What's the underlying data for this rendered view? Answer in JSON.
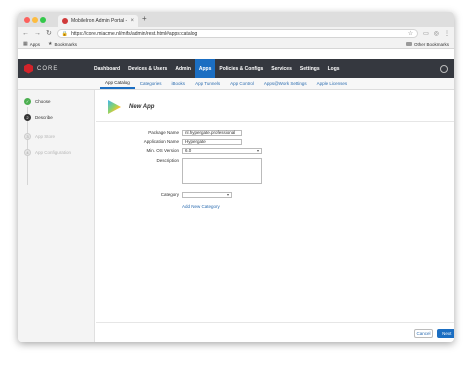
{
  "browser": {
    "tab_title": "MobileIron Admin Portal - Unif",
    "tab_close": "×",
    "new_tab": "+",
    "url": "https://core.miacme.nl/mifs/admin/rest.html#apps:catalog",
    "nav_back": "←",
    "nav_forward": "→",
    "nav_reload": "↻",
    "star": "☆",
    "bookmarks": {
      "apps": "Apps",
      "bookmarks": "Bookmarks",
      "other": "Other Bookmarks"
    }
  },
  "app": {
    "logo_text": "CORE",
    "nav": [
      {
        "label": "Dashboard",
        "active": false
      },
      {
        "label": "Devices & Users",
        "active": false
      },
      {
        "label": "Admin",
        "active": false
      },
      {
        "label": "Apps",
        "active": true
      },
      {
        "label": "Policies & Configs",
        "active": false
      },
      {
        "label": "Services",
        "active": false
      },
      {
        "label": "Settings",
        "active": false
      },
      {
        "label": "Logs",
        "active": false
      }
    ],
    "subnav": [
      {
        "label": "App Catalog",
        "active": true
      },
      {
        "label": "Categories",
        "active": false
      },
      {
        "label": "iBooks",
        "active": false
      },
      {
        "label": "App Tunnels",
        "active": false
      },
      {
        "label": "App Control",
        "active": false
      },
      {
        "label": "Apps@Work Settings",
        "active": false
      },
      {
        "label": "Apple Licenses",
        "active": false
      }
    ]
  },
  "wizard": {
    "steps": [
      {
        "label": "Choose",
        "state": "done",
        "marker": "✓"
      },
      {
        "label": "Describe",
        "state": "current",
        "marker": "2"
      },
      {
        "label": "App Store",
        "state": "todo",
        "marker": "3"
      },
      {
        "label": "App Configuration",
        "state": "todo",
        "marker": "4"
      }
    ]
  },
  "form": {
    "title": "New App",
    "package_name_label": "Package Name",
    "package_name_value": "nl.hypergate.professional",
    "application_name_label": "Application Name",
    "application_name_value": "Hypergate",
    "min_os_label": "Min. OS Version",
    "min_os_value": "6.0",
    "description_label": "Description",
    "category_label": "Category",
    "category_value": "",
    "add_category": "Add New Category"
  },
  "buttons": {
    "cancel": "Cancel",
    "next": "Next",
    "next_arrow": "→"
  },
  "colors": {
    "accent": "#1b6ec2",
    "appbar": "#35383f",
    "brand": "#d2232a",
    "step_done": "#4caf50"
  }
}
